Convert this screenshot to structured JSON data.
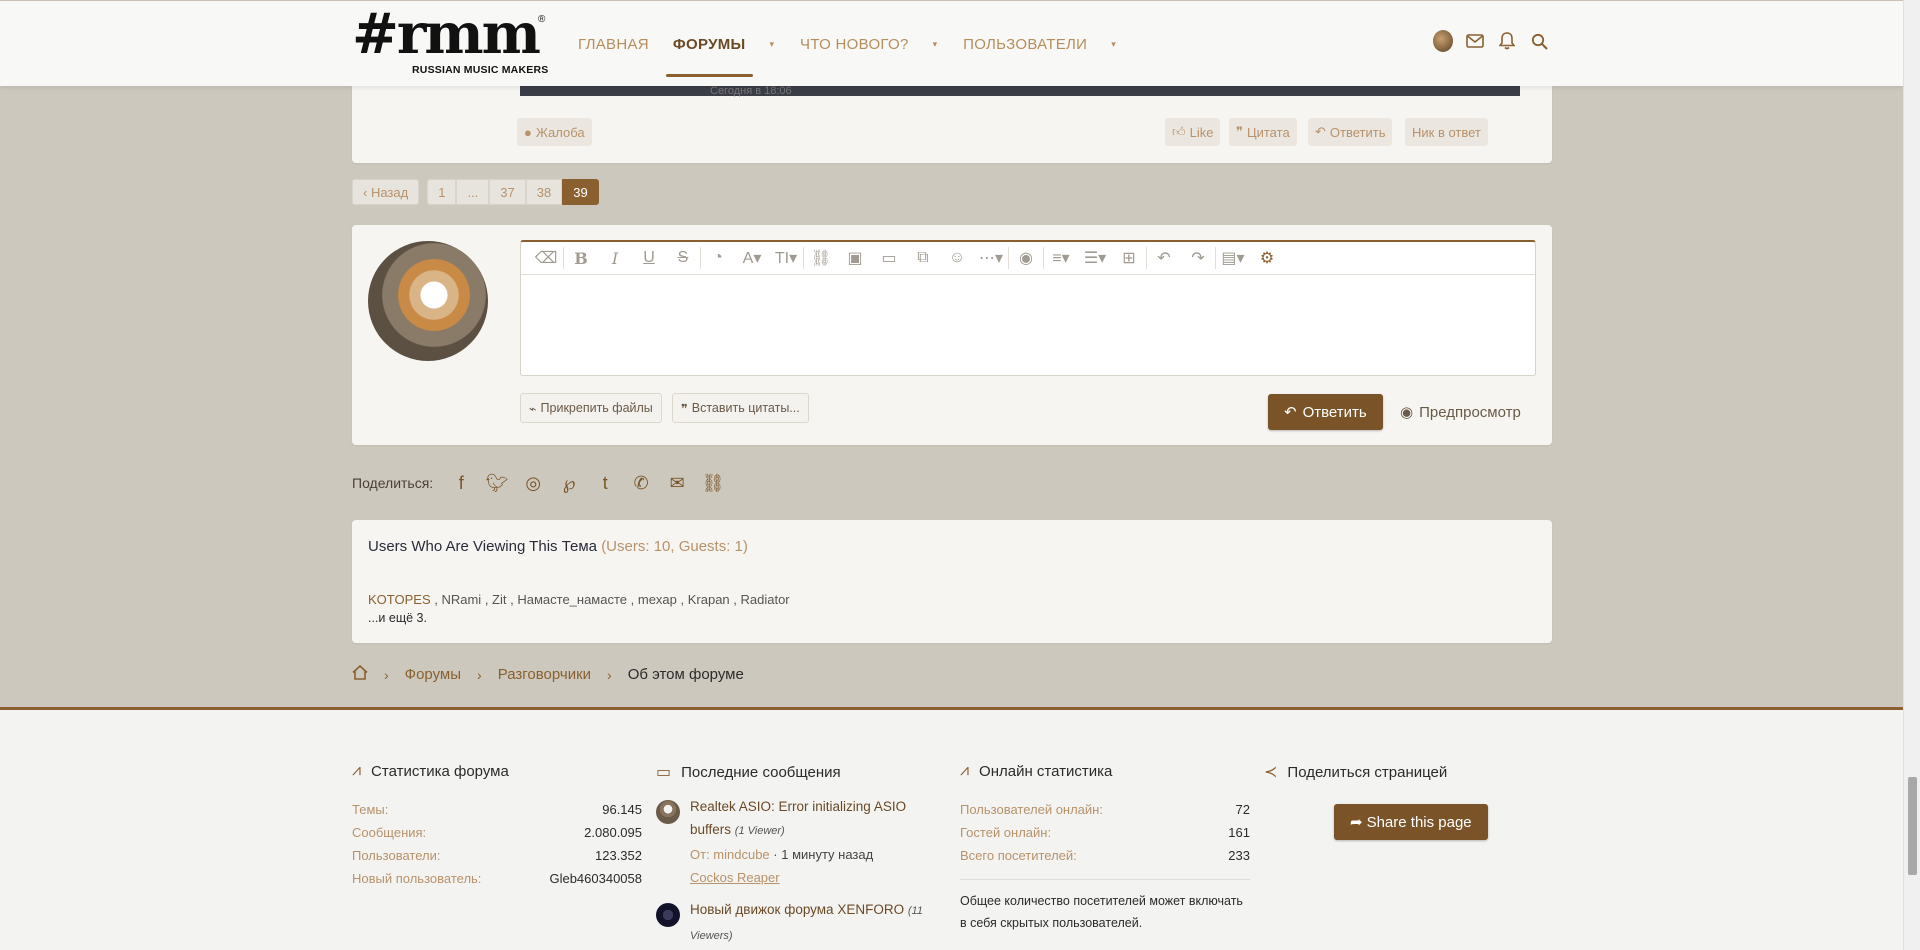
{
  "brand": {
    "logo_mark": "#rmm",
    "logo_reg": "®",
    "logo_sub": "RUSSIAN MUSIC MAKERS"
  },
  "nav": {
    "items": [
      {
        "label": "ГЛАВНАЯ"
      },
      {
        "label": "ФОРУМЫ"
      },
      {
        "label": "ЧТО НОВОГО?"
      },
      {
        "label": "ПОЛЬЗОВАТЕЛИ"
      }
    ],
    "caret": "▾"
  },
  "post": {
    "timestamp_partial": "Сегодня в 18:06",
    "actions": {
      "report": "Жалоба",
      "like": "Like",
      "quote": "Цитата",
      "reply": "Ответить",
      "mention": "Ник в ответ"
    }
  },
  "pagination": {
    "prev": "Назад",
    "pages": [
      "1",
      "...",
      "37",
      "38",
      "39"
    ],
    "current": "39"
  },
  "reply_box": {
    "attach": "Прикрепить файлы",
    "insert_quotes": "Вставить цитаты...",
    "submit": "Ответить",
    "preview": "Предпросмотр",
    "toolbar_icons": [
      "eraser-icon",
      "bold-icon",
      "italic-icon",
      "underline-icon",
      "strikethrough-icon",
      "color-icon",
      "font-family-icon",
      "font-size-icon",
      "link-icon",
      "image-icon",
      "video-icon",
      "media-icon",
      "smilie-icon",
      "more-icon",
      "spoiler-icon",
      "align-icon",
      "list-icon",
      "table-icon",
      "undo-icon",
      "redo-icon",
      "draft-icon",
      "settings-icon"
    ]
  },
  "share": {
    "label": "Поделиться:",
    "networks": [
      "facebook",
      "twitter",
      "reddit",
      "pinterest",
      "tumblr",
      "whatsapp",
      "email",
      "link"
    ]
  },
  "viewers": {
    "title": "Users Who Are Viewing This Тема",
    "count": "(Users: 10, Guests: 1)",
    "users": [
      "KOTOPES",
      "NRami",
      "Zit",
      "Намасте_намасте",
      "mexap",
      "Krapan",
      "Radiator"
    ],
    "more": "...и ещё 3."
  },
  "breadcrumb": {
    "items": [
      "Форумы",
      "Разговорчики"
    ],
    "current": "Об этом форуме"
  },
  "footer": {
    "forum_stats": {
      "title": "Статистика форума",
      "rows": [
        {
          "k": "Темы:",
          "v": "96.145"
        },
        {
          "k": "Сообщения:",
          "v": "2.080.095"
        },
        {
          "k": "Пользователи:",
          "v": "123.352"
        },
        {
          "k": "Новый пользователь:",
          "v": "Gleb460340058"
        }
      ]
    },
    "latest": {
      "title": "Последние сообщения",
      "items": [
        {
          "title": "Realtek ASIO: Error initializing ASIO buffers",
          "viewers": "(1 Viewer)",
          "by_label": "От: mindcube",
          "time": " · 1 минуту назад",
          "forum": "Cockos Reaper"
        },
        {
          "title": "Новый движок форума XENFORO",
          "viewers": "(11 Viewers)"
        }
      ]
    },
    "online": {
      "title": "Онлайн статистика",
      "rows": [
        {
          "k": "Пользователей онлайн:",
          "v": "72"
        },
        {
          "k": "Гостей онлайн:",
          "v": "161"
        },
        {
          "k": "Всего посетителей:",
          "v": "233"
        }
      ],
      "note": "Общее количество посетителей может включать в себя скрытых пользователей."
    },
    "share_page": {
      "title": "Поделиться страницей",
      "button": "Share this page"
    }
  },
  "colors": {
    "accent": "#8a6030",
    "accent_dark": "#7a5428",
    "link": "#b8926a",
    "page_bg": "#ccc8bd"
  }
}
